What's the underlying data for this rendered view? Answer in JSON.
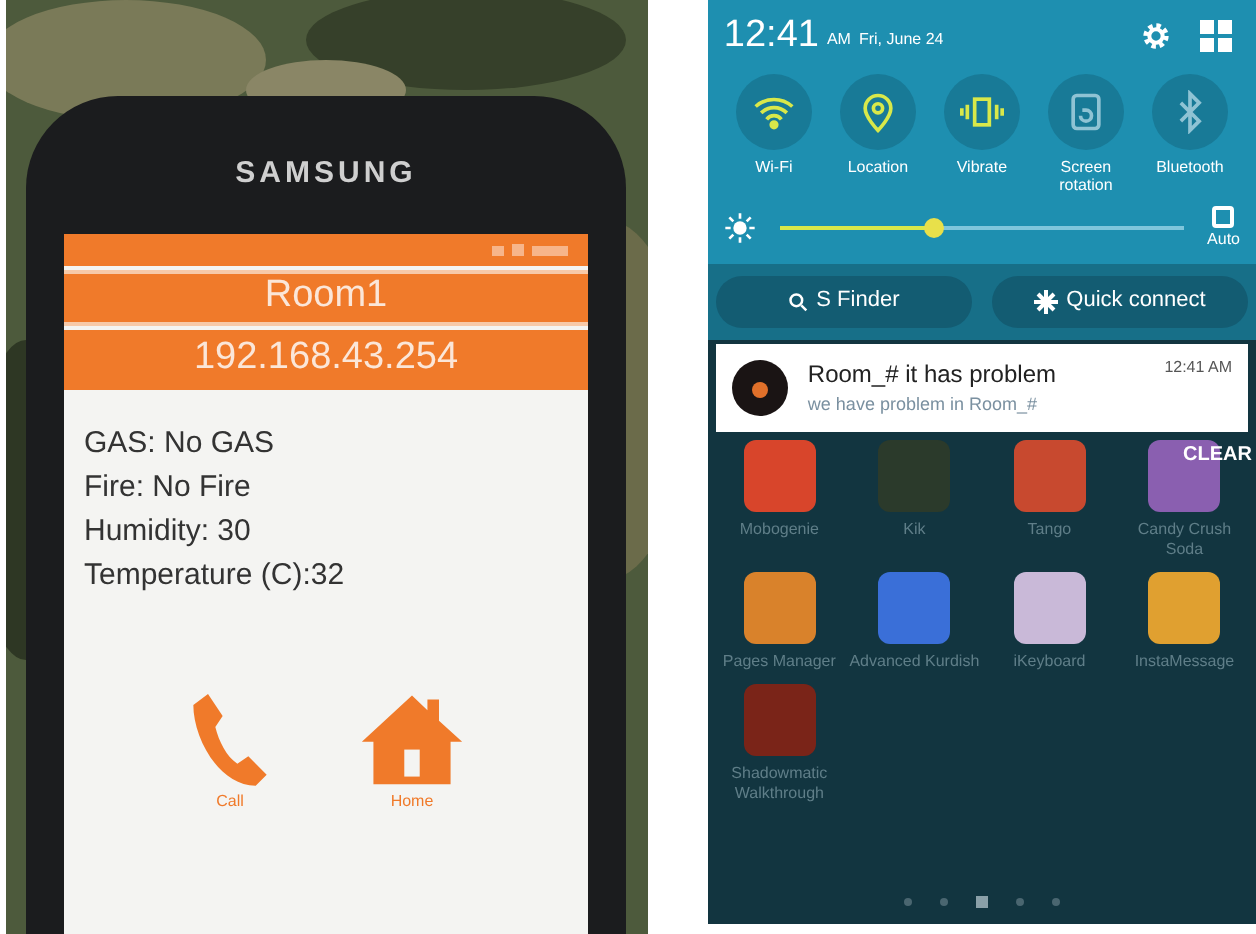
{
  "phone_photo": {
    "brand": "SAMSUNG",
    "app": {
      "title": "Room1",
      "address": "192.168.43.254",
      "readings": [
        "GAS: No GAS",
        "Fire: No Fire",
        "Humidity: 30",
        "Temperature (C):32"
      ],
      "actions": [
        {
          "kind": "call",
          "label": "Call"
        },
        {
          "kind": "home",
          "label": "Home"
        }
      ]
    }
  },
  "notification_panel": {
    "time": "12:41",
    "ampm": "AM",
    "date": "Fri, June 24",
    "toggles": [
      {
        "kind": "wifi",
        "label": "Wi-Fi",
        "on": true
      },
      {
        "kind": "location",
        "label": "Location",
        "on": true
      },
      {
        "kind": "vibrate",
        "label": "Vibrate",
        "on": true
      },
      {
        "kind": "rotation",
        "label": "Screen rotation",
        "on": false
      },
      {
        "kind": "bluetooth",
        "label": "Bluetooth",
        "on": false
      }
    ],
    "brightness": {
      "level": 0.38,
      "auto": {
        "label": "Auto",
        "checked": false
      }
    },
    "buttons": [
      {
        "kind": "finder",
        "label": "S Finder"
      },
      {
        "kind": "connect",
        "label": "Quick connect"
      }
    ],
    "notification": {
      "title": "Room_# it has problem",
      "text": "we have problem in Room_#",
      "time": "12:41 AM"
    },
    "clear": "CLEAR",
    "apps": [
      {
        "label": "Mobogenie",
        "color": "#d8452b"
      },
      {
        "label": "Kik",
        "color": "#2b3a2b"
      },
      {
        "label": "Tango",
        "color": "#c8492f"
      },
      {
        "label": "Candy Crush Soda",
        "color": "#8a5fb0"
      },
      {
        "label": "Pages Manager",
        "color": "#d9822b"
      },
      {
        "label": "Advanced Kurdish",
        "color": "#3a6fd8"
      },
      {
        "label": "iKeyboard",
        "color": "#c9b9d8"
      },
      {
        "label": "InstaMessage",
        "color": "#e0a030"
      },
      {
        "label": "Shadowmatic Walkthrough",
        "color": "#7a2418"
      }
    ],
    "pages": [
      {
        "selected": false
      },
      {
        "selected": false
      },
      {
        "selected": true
      },
      {
        "selected": false
      },
      {
        "selected": false
      }
    ]
  }
}
